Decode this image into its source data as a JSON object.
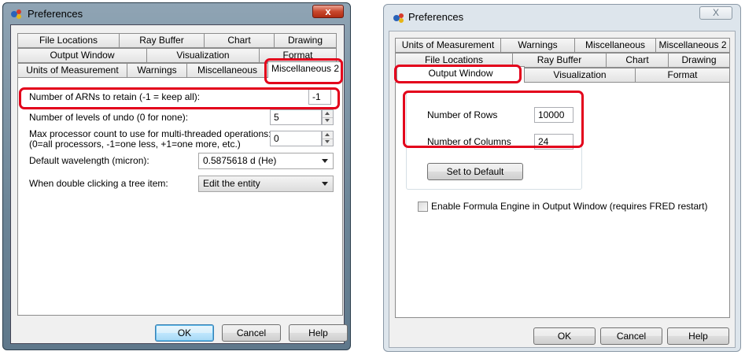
{
  "left": {
    "title": "Preferences",
    "close_label": "x",
    "tabs_row1": [
      "File Locations",
      "Ray Buffer",
      "Chart",
      "Drawing"
    ],
    "tabs_row2": [
      "Output Window",
      "Visualization",
      "Format"
    ],
    "tabs_row3": [
      "Units of Measurement",
      "Warnings",
      "Miscellaneous",
      "Miscellaneous 2"
    ],
    "fields": {
      "arns_label": "Number of ARNs to retain (-1 = keep all):",
      "arns_value": "-1",
      "undo_label": "Number of levels of undo (0 for none):",
      "undo_value": "5",
      "proc_label_1": "Max processor count to use for multi-threaded operations:",
      "proc_label_2": "(0=all processors,  -1=one less,  +1=one more,  etc.)",
      "proc_value": "0",
      "wavelength_label": "Default wavelength (micron):",
      "wavelength_value": "0.5875618  d  (He)",
      "dblclick_label": "When double clicking a tree item:",
      "dblclick_value": "Edit the entity"
    },
    "buttons": {
      "ok": "OK",
      "cancel": "Cancel",
      "help": "Help"
    }
  },
  "right": {
    "title": "Preferences",
    "close_label": "X",
    "tabs_row1": [
      "Units of Measurement",
      "Warnings",
      "Miscellaneous",
      "Miscellaneous 2"
    ],
    "tabs_row2": [
      "File Locations",
      "Ray Buffer",
      "Chart",
      "Drawing"
    ],
    "tabs_row3": [
      "Output Window",
      "Visualization",
      "Format"
    ],
    "rows_label": "Number of Rows",
    "rows_value": "10000",
    "cols_label": "Number of Columns",
    "cols_value": "24",
    "default_button": "Set to Default",
    "formula_label": "Enable Formula Engine in Output Window (requires FRED restart)",
    "buttons": {
      "ok": "OK",
      "cancel": "Cancel",
      "help": "Help"
    }
  },
  "colors": {
    "highlight": "#e3001b",
    "left_frame": "#6c8597",
    "right_frame": "#dde5ec"
  },
  "icons": [
    "preferences-app-icon",
    "close-icon",
    "dropdown-arrow-icon",
    "spin-up-icon",
    "spin-down-icon",
    "checkbox-icon"
  ]
}
